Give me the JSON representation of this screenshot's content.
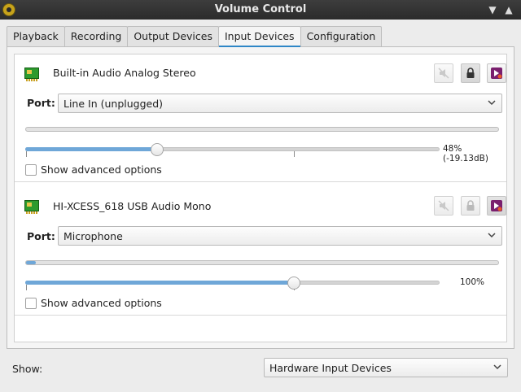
{
  "window": {
    "title": "Volume Control"
  },
  "tabs": [
    {
      "label": "Playback",
      "active": false
    },
    {
      "label": "Recording",
      "active": false
    },
    {
      "label": "Output Devices",
      "active": false
    },
    {
      "label": "Input Devices",
      "active": true
    },
    {
      "label": "Configuration",
      "active": false
    }
  ],
  "devices": [
    {
      "name": "Built-in Audio Analog Stereo",
      "port_label": "Port:",
      "port_value": "Line In (unplugged)",
      "peak_level": 0,
      "volume_percent": 48,
      "volume_text": "48% (-19.13dB)",
      "advanced_label": "Show advanced options",
      "advanced_checked": false,
      "lock_active": true
    },
    {
      "name": "HI-XCESS_618 USB Audio Mono",
      "port_label": "Port:",
      "port_value": "Microphone",
      "peak_level": 0.02,
      "volume_percent": 100,
      "volume_text": "100%",
      "advanced_label": "Show advanced options",
      "advanced_checked": false,
      "lock_active": false
    }
  ],
  "footer": {
    "show_label": "Show:",
    "show_value": "Hardware Input Devices"
  },
  "colors": {
    "accent": "#6fa7d8",
    "titlebar": "#333333",
    "default_device_button": "#7a1f6e"
  },
  "icons": {
    "app": "volume-control-icon",
    "sound_card": "sound-card-icon",
    "mute": "mute-icon",
    "lock": "lock-icon",
    "default": "set-default-icon"
  }
}
